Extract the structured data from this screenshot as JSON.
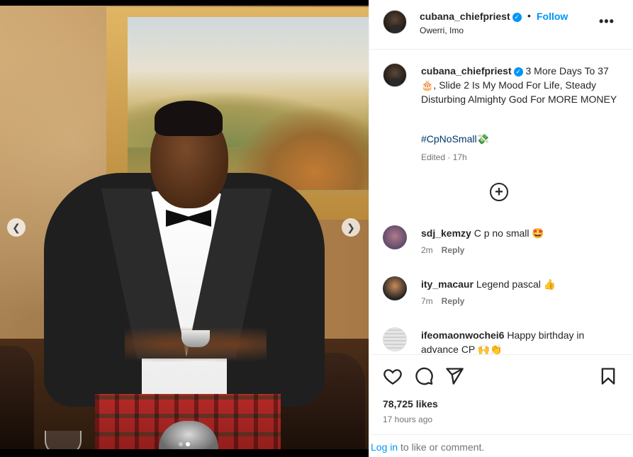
{
  "post": {
    "username": "cubana_chiefpriest",
    "verified_icon": "verified-badge-icon",
    "follow_label": "Follow",
    "bullet": "•",
    "location": "Owerri, Imo",
    "more_label": "•••"
  },
  "caption": {
    "username": "cubana_chiefpriest",
    "text": "3 More Days To 37 🎂, Slide 2 Is My Mood For Life, Steady Disturbing Almighty God For MORE MONEY",
    "hashtag": "#CpNoSmall💸",
    "edited": "Edited · 17h"
  },
  "comments": [
    {
      "username": "sdj_kemzy",
      "text": "C p no small 🤩",
      "time": "2m",
      "reply": "Reply"
    },
    {
      "username": "ity_macaur",
      "text": "Legend pascal 👍",
      "time": "7m",
      "reply": "Reply"
    },
    {
      "username": "ifeomaonwochei6",
      "text": "Happy birthday in advance CP 🙌👏",
      "time": "",
      "reply": ""
    }
  ],
  "actions": {
    "likes": "78,725 likes",
    "time_ago": "17 hours ago",
    "login_link": "Log in",
    "login_rest": " to like or comment."
  },
  "carousel": {
    "slide_count": 2,
    "active_slide": 1
  },
  "colors": {
    "accent": "#0095f6",
    "hashtag": "#00376b",
    "muted": "#737373"
  }
}
